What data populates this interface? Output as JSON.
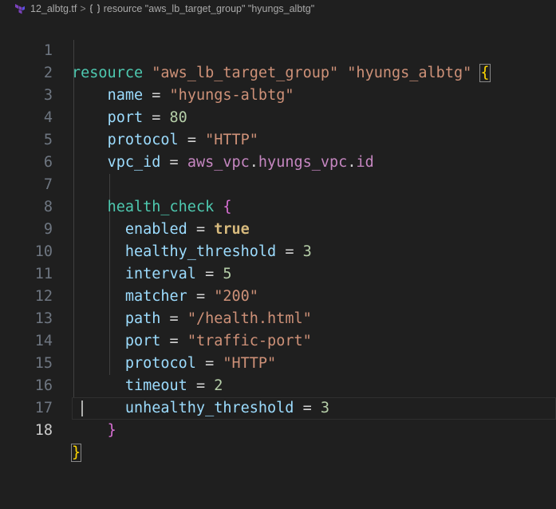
{
  "breadcrumb": {
    "file_name": "12_albtg.tf",
    "separator": ">",
    "symbol_label": "resource \"aws_lb_target_group\" \"hyungs_albtg\""
  },
  "editor": {
    "current_line": 18,
    "lines": [
      {
        "n": "1"
      },
      {
        "n": "2"
      },
      {
        "n": "3"
      },
      {
        "n": "4"
      },
      {
        "n": "5"
      },
      {
        "n": "6"
      },
      {
        "n": "7"
      },
      {
        "n": "8"
      },
      {
        "n": "9"
      },
      {
        "n": "10"
      },
      {
        "n": "11"
      },
      {
        "n": "12"
      },
      {
        "n": "13"
      },
      {
        "n": "14"
      },
      {
        "n": "15"
      },
      {
        "n": "16"
      },
      {
        "n": "17"
      },
      {
        "n": "18"
      }
    ],
    "tokens": {
      "l1_kw": "resource",
      "l1_type": "\"aws_lb_target_group\"",
      "l1_name": "\"hyungs_albtg\"",
      "l1_open": "{",
      "l2_key": "name",
      "l2_val": "\"hyungs-albtg\"",
      "l3_key": "port",
      "l3_val": "80",
      "l4_key": "protocol",
      "l4_val": "\"HTTP\"",
      "l5_key": "vpc_id",
      "l5_ref1": "aws_vpc",
      "l5_ref2": "hyungs_vpc",
      "l5_ref3": "id",
      "l7_block": "health_check",
      "l7_open": "{",
      "l8_key": "enabled",
      "l8_val": "true",
      "l9_key": "healthy_threshold",
      "l9_val": "3",
      "l10_key": "interval",
      "l10_val": "5",
      "l11_key": "matcher",
      "l11_val": "\"200\"",
      "l12_key": "path",
      "l12_val": "\"/health.html\"",
      "l13_key": "port",
      "l13_val": "\"traffic-port\"",
      "l14_key": "protocol",
      "l14_val": "\"HTTP\"",
      "l15_key": "timeout",
      "l15_val": "2",
      "l16_key": "unhealthy_threshold",
      "l16_val": "3",
      "l17_close": "}",
      "l18_close": "}",
      "eq": "=",
      "dot": "."
    }
  },
  "colors": {
    "background": "#1f1f1f",
    "keyword": "#4ec9b0",
    "string": "#ce9178",
    "number": "#b5cea8",
    "bracket_outer": "#ffd700",
    "bracket_inner": "#da70d6"
  }
}
